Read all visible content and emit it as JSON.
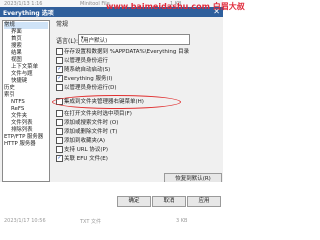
{
  "background_top": {
    "date": "2023/1/13 1:16",
    "name": "Minitool File",
    "size": "1 KB"
  },
  "watermark": "www.baimeidashu.com 白眉大叔",
  "window": {
    "title": "Everything 选项",
    "close": "✕"
  },
  "tree": {
    "items": [
      {
        "label": "常规",
        "indent": 0
      },
      {
        "label": "界面",
        "indent": 1
      },
      {
        "label": "首页",
        "indent": 1
      },
      {
        "label": "搜索",
        "indent": 1
      },
      {
        "label": "结果",
        "indent": 1
      },
      {
        "label": "视图",
        "indent": 1
      },
      {
        "label": "上下文菜单",
        "indent": 1
      },
      {
        "label": "文件与题",
        "indent": 1
      },
      {
        "label": "快捷键",
        "indent": 1
      },
      {
        "label": "历史",
        "indent": 0
      },
      {
        "label": "索引",
        "indent": 0
      },
      {
        "label": "NTFS",
        "indent": 1
      },
      {
        "label": "ReFS",
        "indent": 1
      },
      {
        "label": "文件夹",
        "indent": 1
      },
      {
        "label": "文件列表",
        "indent": 1
      },
      {
        "label": "排除列表",
        "indent": 1
      },
      {
        "label": "ETP/FTP 服务器",
        "indent": 0
      },
      {
        "label": "HTTP 服务器",
        "indent": 0
      }
    ]
  },
  "section_title": "常规",
  "language": {
    "label": "语言(L):",
    "value": "(用户默认)",
    "arrow": "▾"
  },
  "options": [
    {
      "label": "存存设置和数据到 %APPDATA%\\Everything 目录",
      "checked": false
    },
    {
      "label": "以管理员身份运行",
      "checked": false
    },
    {
      "label": "随系统自动启动(S)",
      "checked": true
    },
    {
      "label": "Everything 服务(I)",
      "checked": true
    },
    {
      "label": "以管理员身份运行(D)",
      "checked": false
    },
    {
      "label": "集成到文件夹管理器右键菜单(H)",
      "checked": false
    },
    {
      "label": "在打开文件夹时选中项目(F)",
      "checked": false
    },
    {
      "label": "添加或搜索文件时 (O)",
      "checked": false
    },
    {
      "label": "添加或删除文件时 (T)",
      "checked": false
    },
    {
      "label": "添加到收藏夹(A)",
      "checked": false
    },
    {
      "label": "支持 URL 协议(P)",
      "checked": false
    },
    {
      "label": "关联 EFU 文件(E)",
      "checked": true
    }
  ],
  "restore_button": "恢复到默认(R)",
  "buttons": {
    "ok": "确定",
    "cancel": "取消",
    "apply": "应用"
  },
  "footer": {
    "date": "2023/1/17 10:56",
    "type": "TXT 文件",
    "size": "3 KB"
  }
}
